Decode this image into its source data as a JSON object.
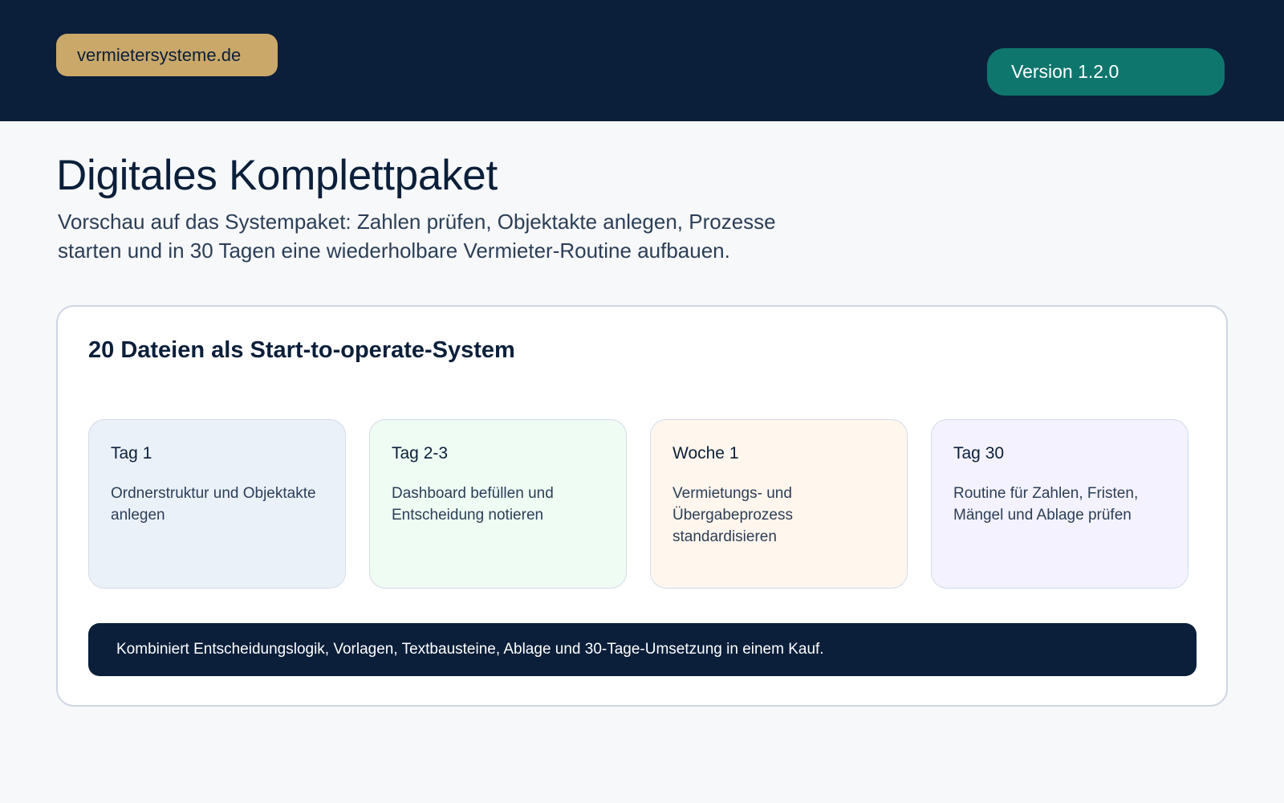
{
  "header": {
    "brand": "vermietersysteme.de",
    "version": "Version 1.2.0",
    "colors": {
      "background": "#0b1f3a",
      "brand_badge": "#c9a86a",
      "version_badge": "#0f766e"
    }
  },
  "main": {
    "title": "Digitales Komplettpaket",
    "subtitle": "Vorschau auf das Systempaket: Zahlen prüfen, Objektakte anlegen, Prozesse starten und in 30 Tagen eine wiederholbare Vermieter-Routine aufbauen."
  },
  "panel": {
    "title": "20 Dateien als Start-to-operate-System",
    "steps": [
      {
        "title": "Tag 1",
        "description": "Ordnerstruktur und Objektakte anlegen",
        "color": "#ebf1f9"
      },
      {
        "title": "Tag 2-3",
        "description": "Dashboard befüllen und Entscheidung notieren",
        "color": "#eefcf3"
      },
      {
        "title": "Woche 1",
        "description": "Vermietungs- und Übergabeprozess standardisieren",
        "color": "#fff6ed"
      },
      {
        "title": "Tag 30",
        "description": "Routine für Zahlen, Fristen, Mängel und Ablage prüfen",
        "color": "#f3f2fe"
      }
    ],
    "summary": "Kombiniert Entscheidungslogik, Vorlagen, Textbausteine, Ablage und 30-Tage-Umsetzung in einem Kauf."
  }
}
